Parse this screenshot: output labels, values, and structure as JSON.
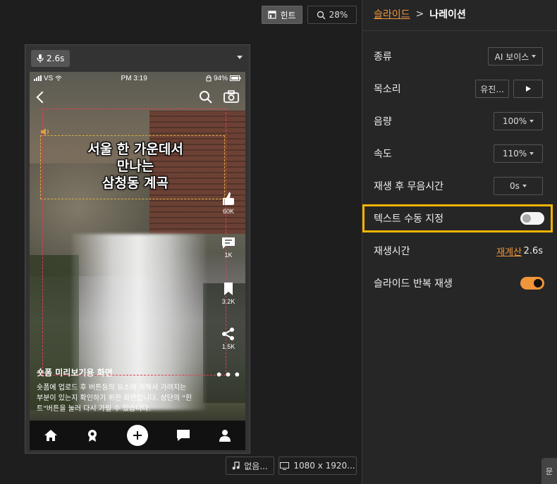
{
  "toolbar": {
    "hint_label": "힌트",
    "zoom_label": "28%"
  },
  "preview": {
    "audio_duration": "2.6s",
    "status": {
      "carrier": "VS",
      "time": "PM 3:19",
      "battery": "94%"
    },
    "overlay_title": [
      "서울 한 가운데서",
      "만나는",
      "삼청동 계곡"
    ],
    "side_actions": [
      {
        "icon": "like-icon",
        "count": "60K"
      },
      {
        "icon": "comment-icon",
        "count": "1K"
      },
      {
        "icon": "bookmark-icon",
        "count": "3.2K"
      },
      {
        "icon": "share-icon",
        "count": "1.5K"
      }
    ],
    "caption_title": "숏폼 미리보기용 화면",
    "caption_lines": [
      "숏폼에 업로드 후 버튼등의 요소에 의해서 가려지는",
      "부분이 있는지 확인하기 위한 화면입니다. 상단의 \"힌",
      "트\"버튼을 눌러 다시 가릴 수 있습니다."
    ],
    "bottom_nav": [
      "home-icon",
      "badge-icon",
      "plus-icon",
      "chat-icon",
      "profile-icon"
    ]
  },
  "canvas_bottom": {
    "music_label": "없음...",
    "resolution_label": "1080 x 1920..."
  },
  "panel": {
    "breadcrumb": {
      "parent": "슬라이드",
      "separator": ">",
      "current": "나레이션"
    },
    "type": {
      "label": "종류",
      "value": "AI 보이스"
    },
    "voice": {
      "label": "목소리",
      "value": "유진..."
    },
    "volume": {
      "label": "음량",
      "value": "100%"
    },
    "speed": {
      "label": "속도",
      "value": "110%"
    },
    "silence": {
      "label": "재생 후 무음시간",
      "value": "0s"
    },
    "manual_text": {
      "label": "텍스트 수동 지정",
      "enabled": false
    },
    "duration": {
      "label": "재생시간",
      "recalc_label": "재계산",
      "value": "2.6s"
    },
    "repeat": {
      "label": "슬라이드 반복 재생",
      "enabled": true
    },
    "corner_tab_label": "문"
  },
  "colors": {
    "accent": "#f0953a",
    "highlight": "#f4b400",
    "panel_bg": "#262626",
    "canvas_bg": "#1e1e1e"
  }
}
